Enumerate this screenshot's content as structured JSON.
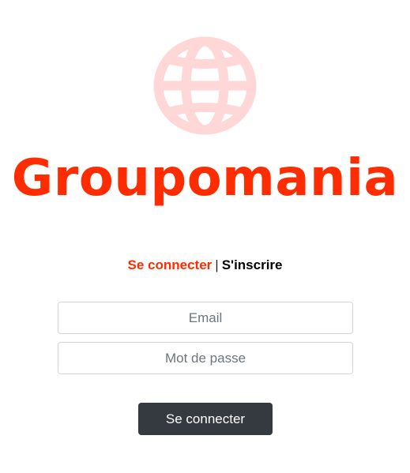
{
  "brand": {
    "name": "Groupomania",
    "logo_icon": "globe-icon",
    "color": "#fd2d01",
    "icon_color": "#ffd7d7"
  },
  "auth_tabs": {
    "login_label": "Se connecter",
    "separator": "|",
    "signup_label": "S'inscrire",
    "active": "login"
  },
  "form": {
    "email_placeholder": "Email",
    "email_value": "",
    "password_placeholder": "Mot de passe",
    "password_value": "",
    "submit_label": "Se connecter",
    "submit_color": "#343a40"
  }
}
